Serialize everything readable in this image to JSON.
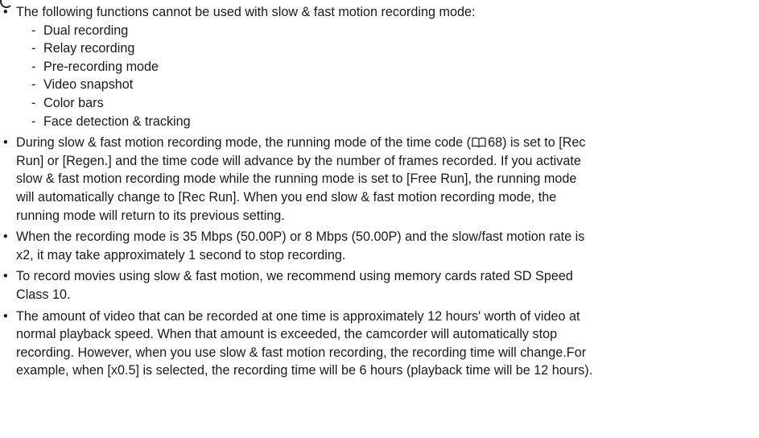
{
  "intro": {
    "text": "The following functions cannot be used with slow & fast motion recording mode:",
    "items": [
      "Dual recording",
      "Relay recording",
      "Pre-recording mode",
      "Video snapshot",
      "Color bars",
      "Face detection & tracking"
    ]
  },
  "note_time_code": {
    "line1_before": "During slow & fast motion recording mode, the running mode of the time code (",
    "page_ref": "68",
    "line1_after": ") is set to [Rec",
    "line2": "Run] or [Regen.] and the time code will advance by the number of frames recorded. If you activate",
    "line3": "slow & fast motion recording mode while the running mode is set to [Free Run], the running mode",
    "line4": "will automatically change to [Rec Run]. When you end slow & fast motion recording mode, the",
    "line5": "running mode will return to its previous setting."
  },
  "note_stop": {
    "line1": "When the recording mode is 35 Mbps (50.00P) or 8 Mbps (50.00P) and the slow/fast motion rate is",
    "line2": "x2, it may take approximately 1 second to stop recording."
  },
  "note_card": {
    "line1": "To record movies using slow & fast motion, we recommend using memory cards rated SD Speed",
    "line2": "Class 10."
  },
  "note_amount": {
    "line1": "The amount of video that can be recorded at one time is approximately 12 hours' worth of video at",
    "line2": "normal playback speed. When that amount is exceeded, the camcorder will automatically stop",
    "line3": "recording. However, when you use slow & fast motion recording, the recording time will change.For",
    "line4": "example, when [x0.5] is selected, the recording time will be 6 hours (playback time will be 12 hours)."
  },
  "bullet_symbol": "•",
  "dash_symbol": "-",
  "icons": {
    "page_reference": "book-icon"
  }
}
